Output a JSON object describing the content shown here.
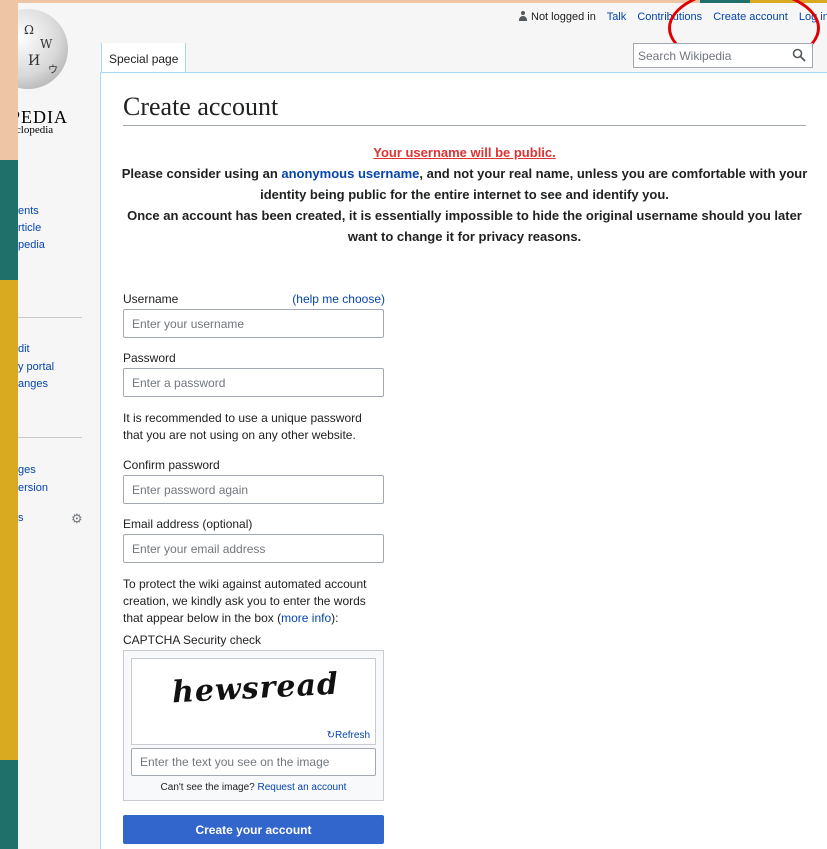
{
  "sidebar": {
    "wordmark": "PEDIA",
    "tagline": "ncyclopedia",
    "nav_group1": [
      "ents",
      "rticle",
      "pedia"
    ],
    "nav_group2": [
      "dit",
      "y portal",
      "anges"
    ],
    "nav_group3": [
      "ges",
      "ersion"
    ],
    "nav_group3_extra": "s"
  },
  "header": {
    "status": "Not logged in",
    "links": [
      "Talk",
      "Contributions",
      "Create account",
      "Log in"
    ],
    "tab": "Special page",
    "search_placeholder": "Search Wikipedia"
  },
  "page": {
    "title": "Create account",
    "warning_public": "Your username will be public.",
    "warning_line1_pre": "Please consider using an ",
    "warning_link": "anonymous username",
    "warning_line1_post": ", and not your real name, unless you are comfortable with your identity being public for the entire internet to see and identify you.",
    "warning_line2": "Once an account has been created, it is essentially impossible to hide the original username should you later want to change it for privacy reasons."
  },
  "form": {
    "username_label": "Username",
    "username_help": "(help me choose)",
    "username_placeholder": "Enter your username",
    "password_label": "Password",
    "password_placeholder": "Enter a password",
    "password_note": "It is recommended to use a unique password that you are not using on any other website.",
    "confirm_label": "Confirm password",
    "confirm_placeholder": "Enter password again",
    "email_label": "Email address (optional)",
    "email_placeholder": "Enter your email address",
    "captcha_note_pre": "To protect the wiki against automated account creation, we kindly ask you to enter the words that appear below in the box (",
    "captcha_note_link": "more info",
    "captcha_note_post": "):",
    "captcha_label": "CAPTCHA Security check",
    "captcha_word": "hewsread",
    "refresh_label": "Refresh",
    "captcha_placeholder": "Enter the text you see on the image",
    "captcha_help_pre": "Can't see the image? ",
    "captcha_help_link": "Request an account",
    "submit_label": "Create your account"
  },
  "colors": {
    "link": "#0645ad",
    "warning": "#dd3333",
    "submit": "#3366cc",
    "annotation": "#e00000"
  }
}
